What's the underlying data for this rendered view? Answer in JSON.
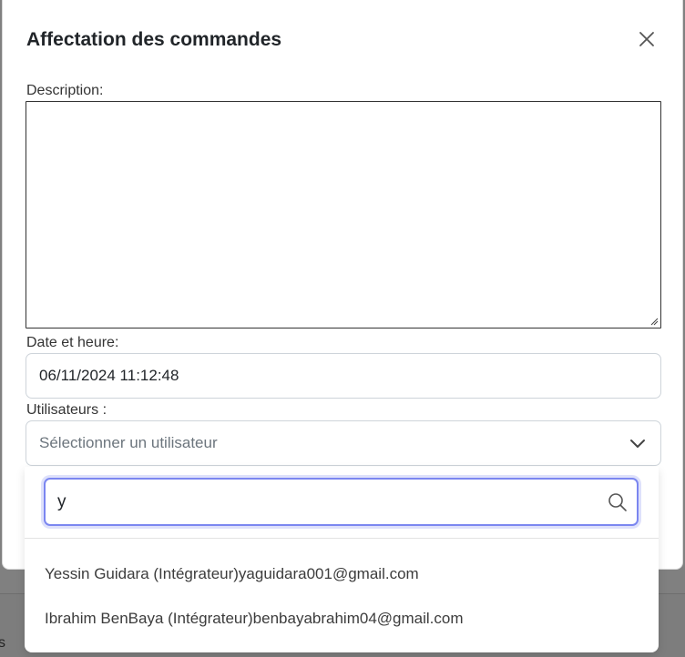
{
  "modal": {
    "title": "Affectation des commandes",
    "close_icon": "close-icon"
  },
  "form": {
    "description_label": "Description:",
    "description_value": "",
    "date_label": "Date et heure:",
    "date_value": "06/11/2024 11:12:48",
    "users_label": "Utilisateurs :",
    "users_placeholder": "Sélectionner un utilisateur"
  },
  "dropdown": {
    "search_value": "y",
    "options": [
      "Yessin Guidara (Intégrateur)yaguidara001@gmail.com",
      "Ibrahim BenBaya (Intégrateur)benbayabrahim04@gmail.com"
    ]
  },
  "background": {
    "edge_text": "s"
  },
  "colors": {
    "focus_ring": "#7b86f0",
    "border": "#ced4da",
    "overlay": "#808080"
  }
}
